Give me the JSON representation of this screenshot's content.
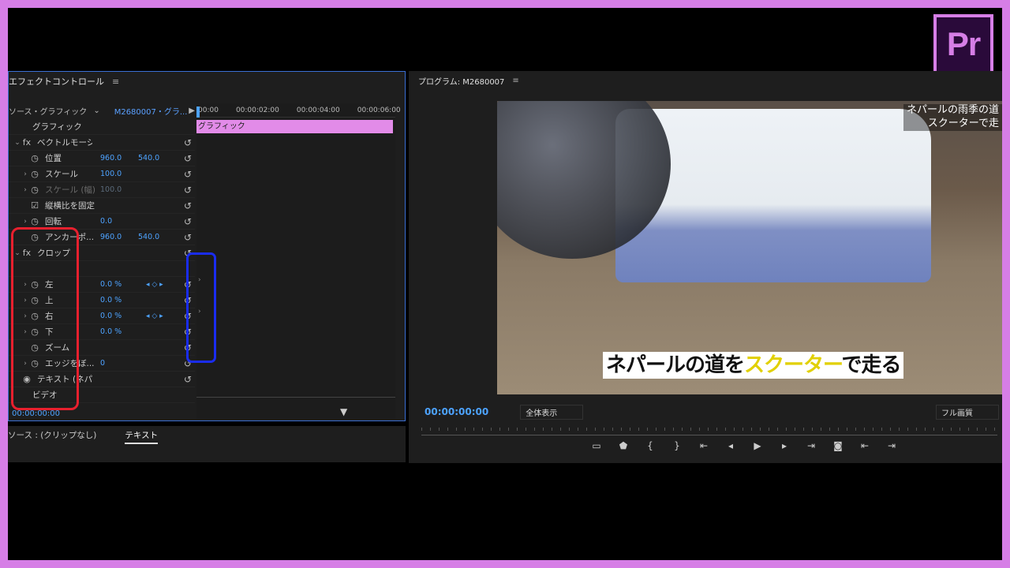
{
  "app_logo": "Pr",
  "effect_controls": {
    "title": "エフェクトコントロール",
    "source": "ソース・グラフィック",
    "clip": "M2680007・グラ...",
    "ruler": [
      "00:00",
      "00:00:02:00",
      "00:00:04:00",
      "00:00:06:00"
    ],
    "clip_label": "グラフィック",
    "rows": [
      {
        "label": "グラフィック",
        "tw": "",
        "sw": "",
        "v1": "",
        "v2": "",
        "dim": false,
        "reset": false
      },
      {
        "label": "ベクトルモーション",
        "tw": "⌄",
        "sw": "fx",
        "v1": "",
        "v2": "",
        "dim": false,
        "reset": true
      },
      {
        "label": "位置",
        "tw": "",
        "sw": "◷",
        "v1": "960.0",
        "v2": "540.0",
        "dim": false,
        "reset": true
      },
      {
        "label": "スケール",
        "tw": "›",
        "sw": "◷",
        "v1": "100.0",
        "v2": "",
        "dim": false,
        "reset": true
      },
      {
        "label": "スケール (幅)",
        "tw": "›",
        "sw": "◷",
        "v1": "100.0",
        "v2": "",
        "dim": true,
        "reset": true
      },
      {
        "label": "縦横比を固定",
        "tw": "",
        "sw": "☑",
        "v1": "",
        "v2": "",
        "dim": false,
        "reset": true
      },
      {
        "label": "回転",
        "tw": "›",
        "sw": "◷",
        "v1": "0.0",
        "v2": "",
        "dim": false,
        "reset": true
      },
      {
        "label": "アンカーポ...",
        "tw": "",
        "sw": "◷",
        "v1": "960.0",
        "v2": "540.0",
        "dim": false,
        "reset": true
      },
      {
        "label": "クロップ",
        "tw": "⌄",
        "sw": "fx",
        "v1": "",
        "v2": "",
        "dim": false,
        "reset": true
      },
      {
        "label": "",
        "tw": "",
        "sw": "",
        "v1": "",
        "v2": "",
        "dim": false,
        "reset": false
      },
      {
        "label": "左",
        "tw": "›",
        "sw": "◷",
        "v1": "0.0 %",
        "v2": "",
        "dim": false,
        "reset": true,
        "kf": true
      },
      {
        "label": "上",
        "tw": "›",
        "sw": "◷",
        "v1": "0.0 %",
        "v2": "",
        "dim": false,
        "reset": true
      },
      {
        "label": "右",
        "tw": "›",
        "sw": "◷",
        "v1": "0.0 %",
        "v2": "",
        "dim": false,
        "reset": true,
        "kf": true
      },
      {
        "label": "下",
        "tw": "›",
        "sw": "◷",
        "v1": "0.0 %",
        "v2": "",
        "dim": false,
        "reset": true
      },
      {
        "label": "ズーム",
        "tw": "",
        "sw": "◷",
        "v1": "",
        "v2": "",
        "dim": false,
        "reset": true
      },
      {
        "label": "エッジをぼ...",
        "tw": "›",
        "sw": "◷",
        "v1": "0",
        "v2": "",
        "dim": false,
        "reset": true
      },
      {
        "label": "テキスト (ネパールの道をスク...",
        "tw": "",
        "sw": "◉",
        "v1": "",
        "v2": "",
        "dim": false,
        "reset": true
      },
      {
        "label": "ビデオ",
        "tw": "",
        "sw": "",
        "v1": "",
        "v2": "",
        "dim": false,
        "reset": false
      }
    ],
    "timecode": "00:00:00:00"
  },
  "bottom_left": {
    "tabs": [
      "ソース : (クリップなし)",
      "テキスト"
    ]
  },
  "program": {
    "title": "プログラム: M2680007",
    "caption_top": [
      "ネパールの雨季の道",
      "スクーターで走"
    ],
    "caption_parts": [
      "ネパールの道を",
      "スクーター",
      "で走る"
    ],
    "timecode": "00:00:00:00",
    "zoom": "全体表示",
    "quality": "フル画質"
  },
  "colors": {
    "accent": "#4da3ff",
    "border": "#d67ee6",
    "red_box": "#e8202e",
    "blue_box": "#1a2cf0",
    "highlight": "#e1d000"
  }
}
